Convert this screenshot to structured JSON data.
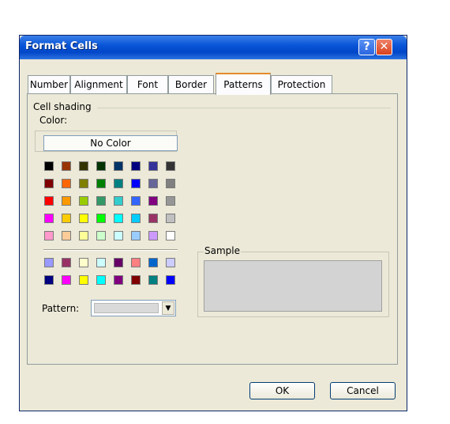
{
  "dialog": {
    "title": "Format Cells",
    "help_glyph": "?",
    "close_glyph": "✕"
  },
  "tabs": [
    {
      "label": "Number"
    },
    {
      "label": "Alignment"
    },
    {
      "label": "Font"
    },
    {
      "label": "Border"
    },
    {
      "label": "Patterns",
      "active": true
    },
    {
      "label": "Protection"
    }
  ],
  "cell_shading": {
    "group_label": "Cell shading",
    "color_label": "Color:",
    "no_color_label": "No Color",
    "standard_colors": [
      "#000000",
      "#993300",
      "#333300",
      "#003300",
      "#003366",
      "#000080",
      "#333399",
      "#333333",
      "#800000",
      "#FF6600",
      "#808000",
      "#008000",
      "#008080",
      "#0000FF",
      "#666699",
      "#808080",
      "#FF0000",
      "#FF9900",
      "#99CC00",
      "#339966",
      "#33CCCC",
      "#3366FF",
      "#800080",
      "#969696",
      "#FF00FF",
      "#FFCC00",
      "#FFFF00",
      "#00FF00",
      "#00FFFF",
      "#00CCFF",
      "#993366",
      "#C0C0C0",
      "#FF99CC",
      "#FFCC99",
      "#FFFF99",
      "#CCFFCC",
      "#CCFFFF",
      "#99CCFF",
      "#CC99FF",
      "#FFFFFF"
    ],
    "chart_colors": [
      "#9999FF",
      "#993366",
      "#FFFFCC",
      "#CCFFFF",
      "#660066",
      "#FF8080",
      "#0066CC",
      "#CCCCFF",
      "#000080",
      "#FF00FF",
      "#FFFF00",
      "#00FFFF",
      "#800080",
      "#800000",
      "#008080",
      "#0000FF"
    ],
    "pattern_label": "Pattern:",
    "pattern_arrow": "▼"
  },
  "sample": {
    "label": "Sample"
  },
  "buttons": {
    "ok": "OK",
    "cancel": "Cancel"
  }
}
